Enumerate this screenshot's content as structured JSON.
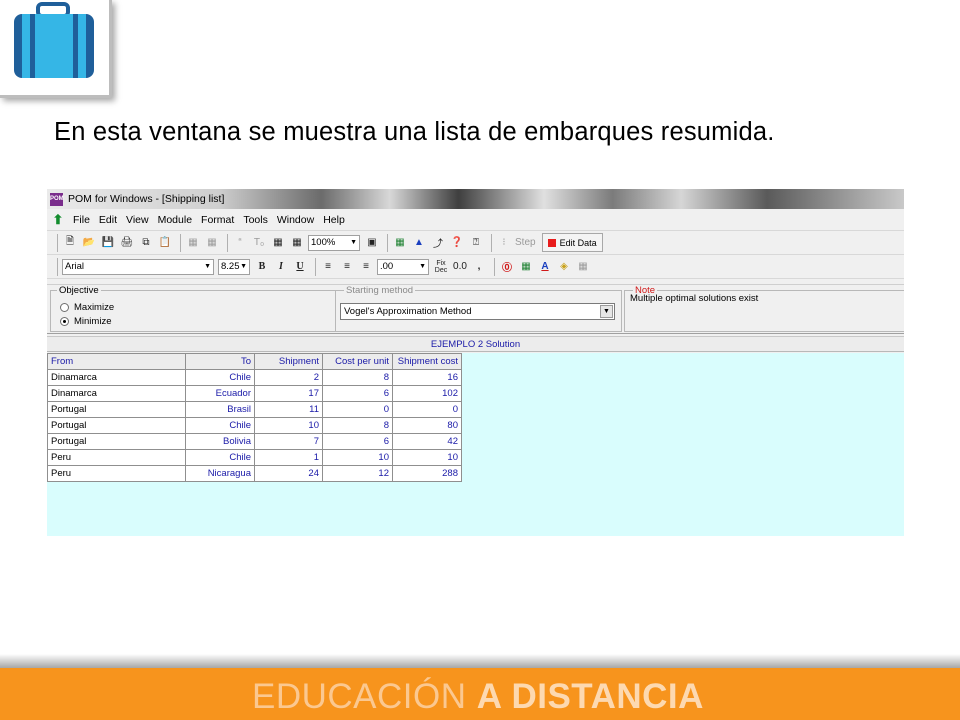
{
  "slide": {
    "caption": "En esta ventana se muestra una lista de embarques resumida.",
    "footer_light": "EDUCACIÓN",
    "footer_bold": "A DISTANCIA",
    "logo_icon": "suitcase-icon",
    "colors": {
      "footer": "#f7941d",
      "suitcase": "#1aa3d9"
    }
  },
  "window": {
    "title": "POM for Windows - [Shipping list]",
    "app_icon_text": "POM",
    "menu": [
      "File",
      "Edit",
      "View",
      "Module",
      "Format",
      "Tools",
      "Window",
      "Help"
    ],
    "toolbar1": {
      "zoom": "100%",
      "step_label": "Step",
      "edit_data_label": "Edit Data"
    },
    "toolbar2": {
      "font_name": "Arial",
      "font_size": "8.25",
      "bold": "B",
      "italic": "I",
      "underline": "U",
      "decimal_format": ".00",
      "fix_dec": "Fix Dec",
      "zero_format": "0.0",
      "comma": ","
    },
    "objective": {
      "label": "Objective",
      "options": [
        "Maximize",
        "Minimize"
      ],
      "selected": "Minimize"
    },
    "starting_method": {
      "label": "Starting method",
      "value": "Vogel's Approximation Method"
    },
    "note": {
      "label": "Note",
      "text": "Multiple optimal solutions exist"
    },
    "solution_title": "EJEMPLO 2 Solution",
    "table": {
      "headers": [
        "From",
        "To",
        "Shipment",
        "Cost per unit",
        "Shipment cost"
      ],
      "rows": [
        [
          "Dinamarca",
          "Chile",
          "2",
          "8",
          "16"
        ],
        [
          "Dinamarca",
          "Ecuador",
          "17",
          "6",
          "102"
        ],
        [
          "Portugal",
          "Brasil",
          "11",
          "0",
          "0"
        ],
        [
          "Portugal",
          "Chile",
          "10",
          "8",
          "80"
        ],
        [
          "Portugal",
          "Bolivia",
          "7",
          "6",
          "42"
        ],
        [
          "Peru",
          "Chile",
          "1",
          "10",
          "10"
        ],
        [
          "Peru",
          "Nicaragua",
          "24",
          "12",
          "288"
        ]
      ]
    }
  }
}
